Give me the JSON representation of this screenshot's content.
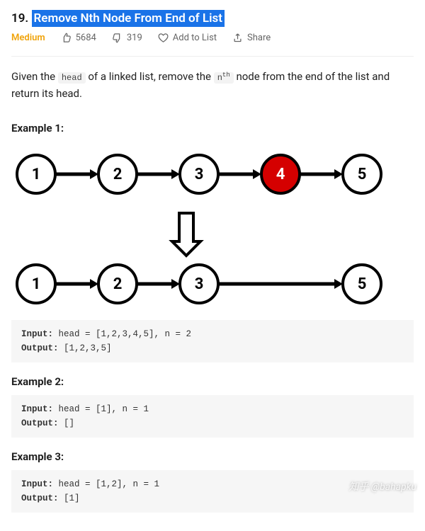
{
  "problem": {
    "number_prefix": "19.",
    "title": "Remove Nth Node From End of List",
    "difficulty": "Medium",
    "likes": "5684",
    "dislikes": "319",
    "add_to_list": "Add to List",
    "share": "Share"
  },
  "description": {
    "prefix": "Given the ",
    "code1": "head",
    "mid": " of a linked list, remove the ",
    "code2_html": "n<sup>th</sup>",
    "suffix": " node from the end of the list and return its head."
  },
  "examples": [
    {
      "title": "Example 1:",
      "has_diagram": true,
      "input": "head = [1,2,3,4,5], n = 2",
      "output": "[1,2,3,5]"
    },
    {
      "title": "Example 2:",
      "has_diagram": false,
      "input": "head = [1], n = 1",
      "output": "[]"
    },
    {
      "title": "Example 3:",
      "has_diagram": false,
      "input": "head = [1,2], n = 1",
      "output": "[1]"
    }
  ],
  "labels": {
    "input": "Input:",
    "output": "Output:"
  },
  "diagram": {
    "top_nodes": [
      "1",
      "2",
      "3",
      "4",
      "5"
    ],
    "highlight_index": 3,
    "bottom_nodes": [
      "1",
      "2",
      "3",
      "",
      "5"
    ]
  },
  "watermark": "知乎 @bahapku"
}
